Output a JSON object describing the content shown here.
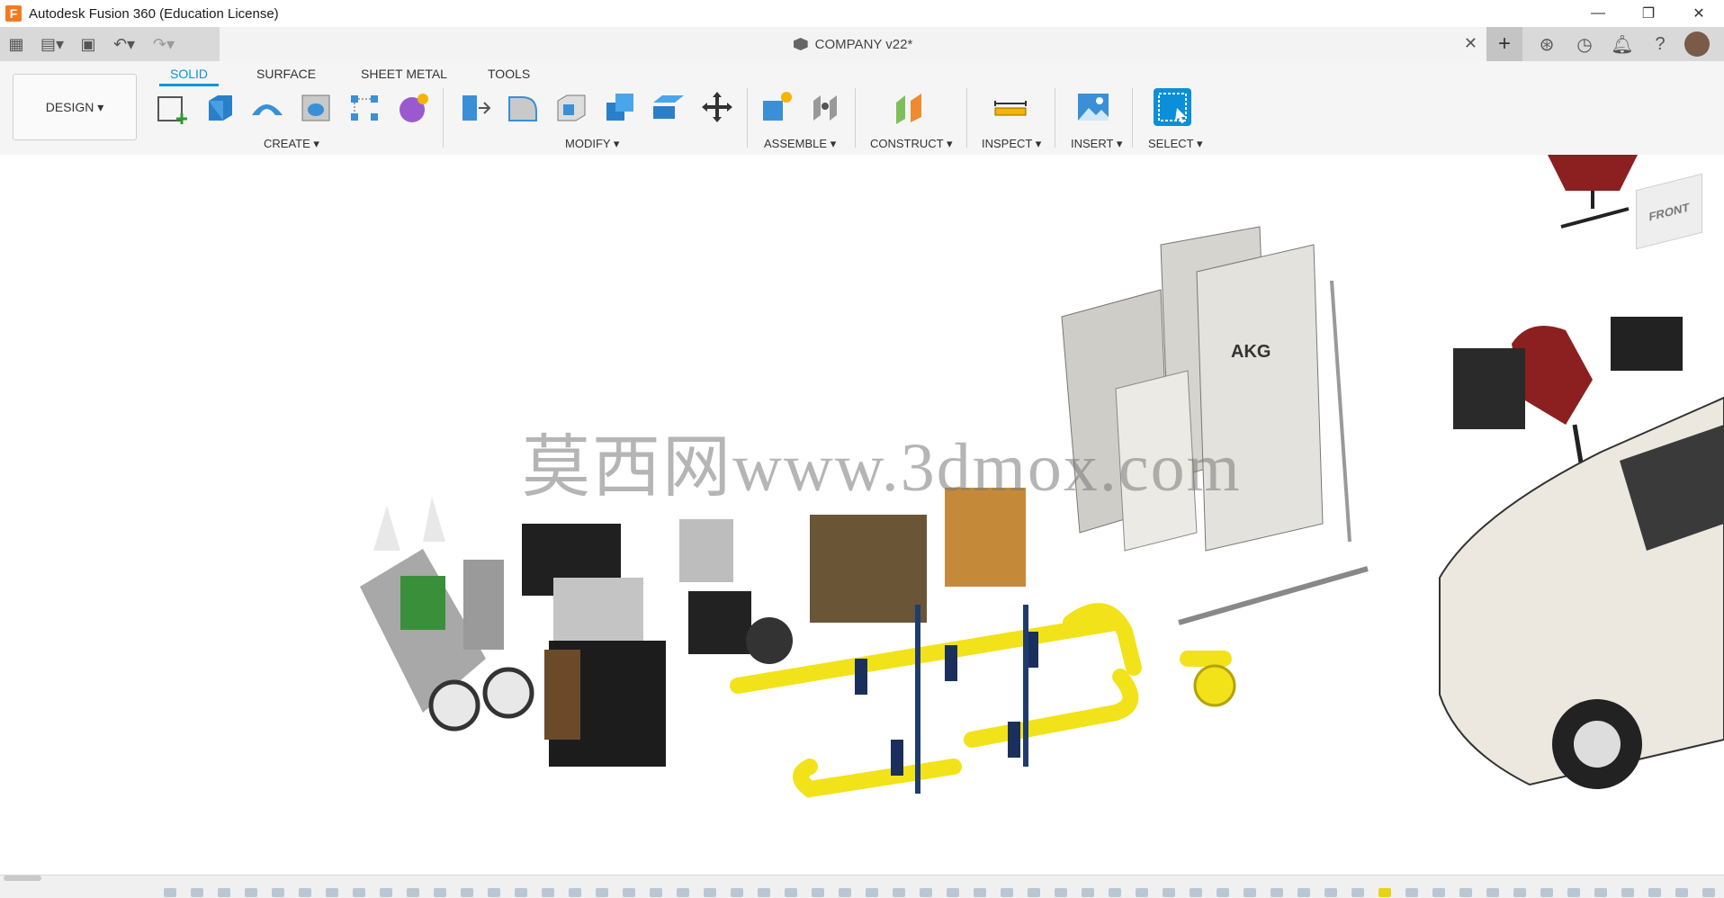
{
  "window": {
    "title": "Autodesk Fusion 360 (Education License)",
    "logo_letter": "F",
    "controls": {
      "minimize": "—",
      "maximize": "❐",
      "close": "✕"
    }
  },
  "doc_tab": {
    "title": "COMPANY v22*",
    "close": "✕"
  },
  "ribbon": {
    "workspace": "DESIGN ▾",
    "tabs": [
      "SOLID",
      "SURFACE",
      "SHEET METAL",
      "TOOLS"
    ],
    "active_tab": "SOLID",
    "groups": [
      "CREATE ▾",
      "MODIFY ▾",
      "ASSEMBLE ▾",
      "CONSTRUCT ▾",
      "INSPECT ▾",
      "INSERT ▾",
      "SELECT ▾"
    ]
  },
  "viewport": {
    "watermark": "莫西网www.3dmox.com",
    "viewcube_face": "FRONT",
    "sign_text": "AKG"
  },
  "colors": {
    "accent": "#0696d7",
    "logo": "#f47a20",
    "pipe_yellow": "#f2e21a"
  }
}
